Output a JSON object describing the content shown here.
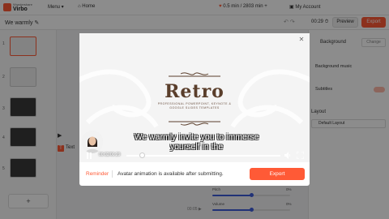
{
  "topbar": {
    "brand_small": "Wondershare",
    "brand": "Virbo",
    "menu_label": "Menu ▾",
    "home_label": "⌂ Home",
    "usage_text": "0.5 min / 2803 min",
    "usage_add": "+",
    "account_label": "My Account"
  },
  "toolbar": {
    "project_name": "We warmly ✎",
    "time_display": "00:29 ⏱",
    "preview_label": "Preview",
    "export_label": "Export"
  },
  "slides": [
    {
      "num": "1"
    },
    {
      "num": "2"
    },
    {
      "num": "3"
    },
    {
      "num": "4"
    },
    {
      "num": "5"
    }
  ],
  "add_slide": "+",
  "right_panel": {
    "background_label": "Background",
    "change_label": "Change",
    "background_music_label": "Background music",
    "subtitles_label": "Subtitles",
    "layout_label": "Layout",
    "default_layout": "Default Layout"
  },
  "sliders": [
    {
      "label": "Pitch",
      "pct": "0%",
      "level": 0.5
    },
    {
      "label": "Volume",
      "pct": "0%",
      "level": 0.5
    }
  ],
  "modal": {
    "slide_title": "Retro",
    "slide_subtitle_1": "PROFESSIONAL POWERPOINT, KEYNOTE &",
    "slide_subtitle_2": "GOOGLE SLIDES TEMPLATES",
    "caption_1": "We warmly invite you to immerse",
    "caption_2": "yourself in the",
    "player_time": "00:02/00:29",
    "progress": 0.1,
    "reminder_label": "Reminder",
    "reminder_text": "Avatar animation is available after submitting.",
    "export_label": "Export"
  },
  "editor_peek": {
    "text_label": "Text",
    "time_label": "00:05 ▶"
  },
  "colors": {
    "accent": "#ff5a36",
    "slider": "#3d5bd9",
    "title": "#5a3e2b"
  }
}
